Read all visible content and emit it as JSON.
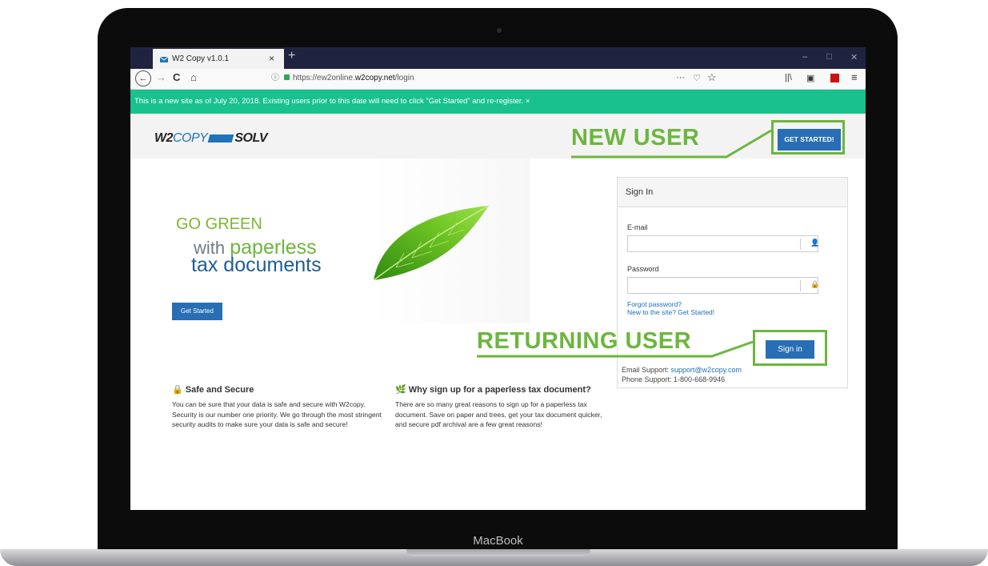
{
  "tab": {
    "title": "W2 Copy v1.0.1",
    "close": "×",
    "new": "+"
  },
  "window": {
    "minimize": "–",
    "maximize": "□",
    "close": "✕"
  },
  "nav": {
    "back": "←",
    "forward": "→",
    "reload": "C",
    "home": "⌂",
    "url_prefix": "https://ew2online.",
    "url_domain": "w2copy.net",
    "url_path": "/login",
    "more": "···",
    "pocket": "♡",
    "star": "☆",
    "library": "||\\",
    "sidebar": "▣",
    "menu": "≡"
  },
  "notice": "This is a new site as of July 20, 2018. Existing users prior to this date will need to click \"Get Started\" and re-register. ×",
  "logo": {
    "w2": "W2",
    "copy": "COPY",
    "solv": "SOLV"
  },
  "header": {
    "get_started": "GET STARTED!"
  },
  "annotations": {
    "new_user": "NEW USER",
    "returning_user": "RETURNING USER"
  },
  "hero": {
    "line1": "GO GREEN",
    "with": "with",
    "paperless": "paperless",
    "line3": "tax documents",
    "button": "Get Started"
  },
  "signin": {
    "title": "Sign In",
    "email_label": "E-mail",
    "password_label": "Password",
    "forgot": "Forgot password?",
    "new_to_site": "New to the site? Get Started!",
    "button": "Sign in",
    "email_support_label": "Email Support: ",
    "email_support": "support@w2copy.com",
    "phone_support": "Phone Support: 1-800-668-9946"
  },
  "info": {
    "safe_title": "Safe and Secure",
    "safe_text": "You can be sure that your data is safe and secure with W2copy. Security is our number one priority. We go through the most stringent security audits to make sure your data is safe and secure!",
    "why_title": "Why sign up for a paperless tax document?",
    "why_text": "There are so many great reasons to sign up for a paperless tax document. Save on paper and trees, get your tax document quicker, and secure pdf archival are a few great reasons!"
  },
  "laptop": {
    "brand": "MacBook"
  },
  "colors": {
    "notice_bg": "#19c18e",
    "primary": "#276eb4",
    "annotation": "#6cb63e"
  }
}
